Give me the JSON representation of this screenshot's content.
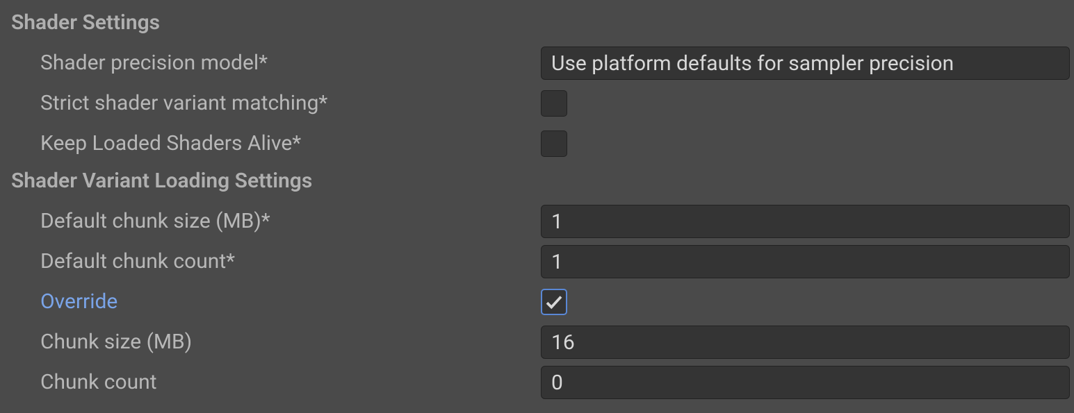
{
  "sections": {
    "shader_settings": {
      "title": "Shader Settings",
      "precision_model_label": "Shader precision model*",
      "precision_model_value": "Use platform defaults for sampler precision",
      "strict_matching_label": "Strict shader variant matching*",
      "strict_matching_checked": false,
      "keep_loaded_label": "Keep Loaded Shaders Alive*",
      "keep_loaded_checked": false
    },
    "variant_loading": {
      "title": "Shader Variant Loading Settings",
      "default_chunk_size_label": "Default chunk size (MB)*",
      "default_chunk_size_value": "1",
      "default_chunk_count_label": "Default chunk count*",
      "default_chunk_count_value": "1",
      "override_label": "Override",
      "override_checked": true,
      "chunk_size_label": "Chunk size (MB)",
      "chunk_size_value": "16",
      "chunk_count_label": "Chunk count",
      "chunk_count_value": "0"
    }
  }
}
